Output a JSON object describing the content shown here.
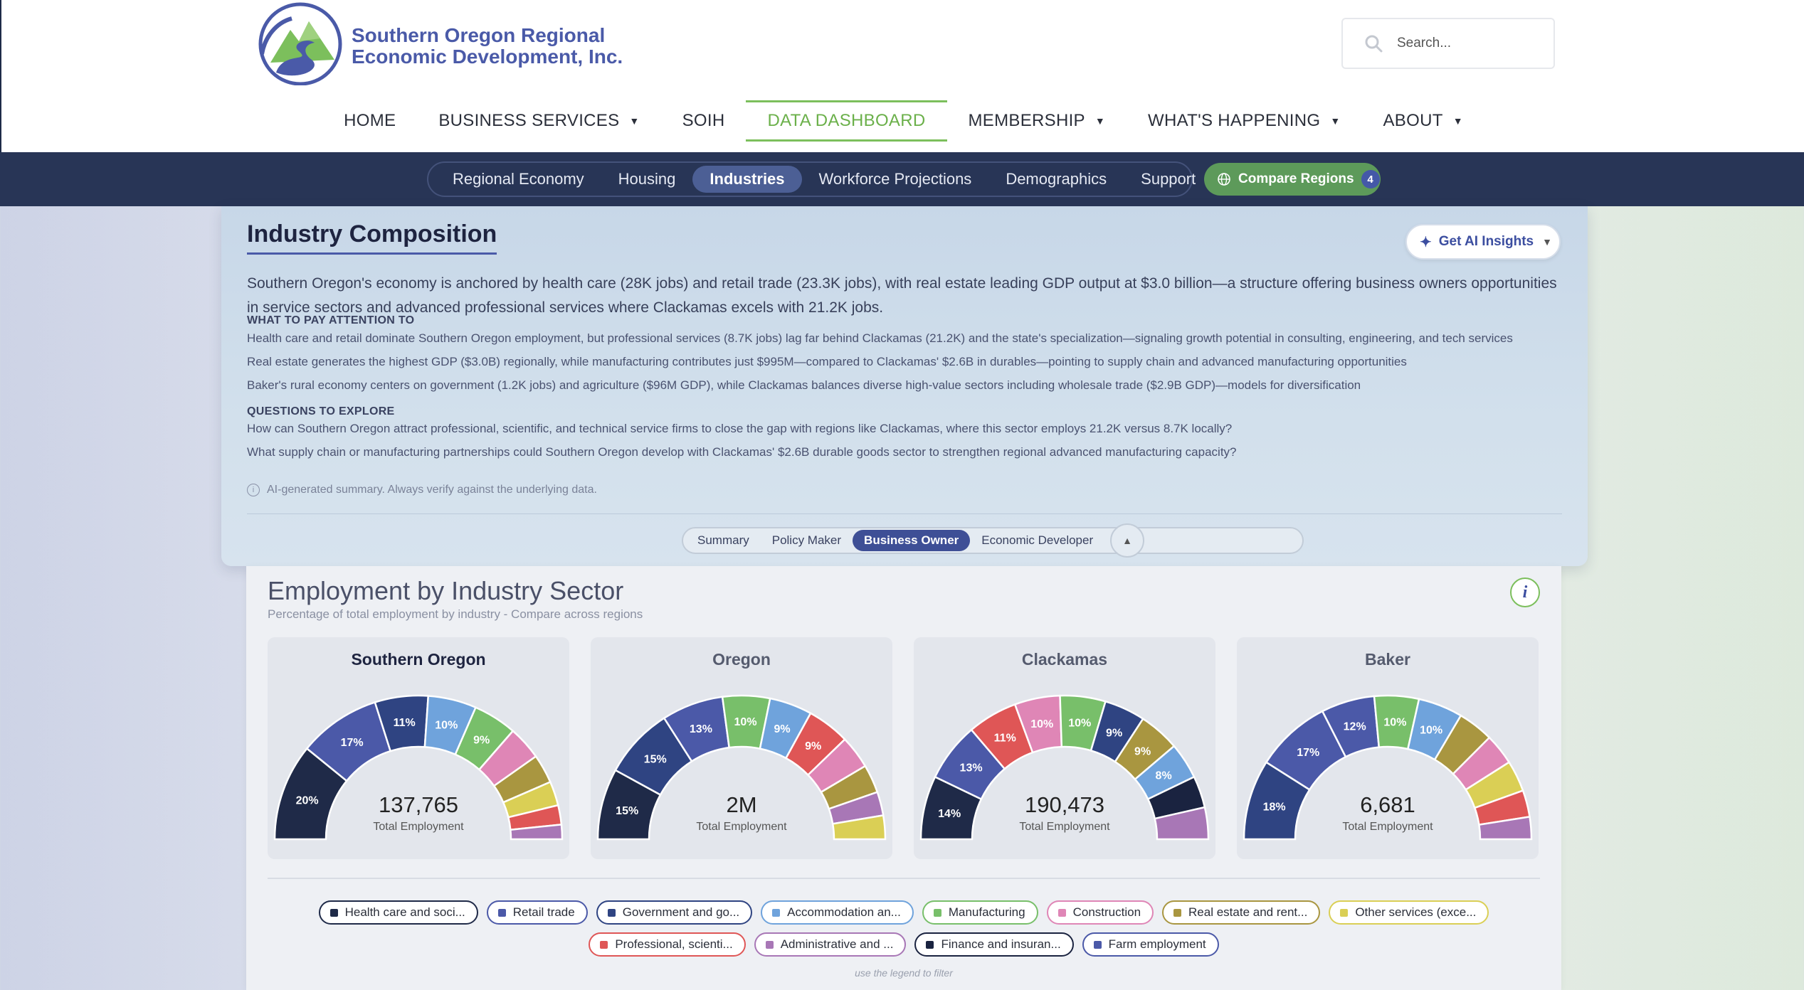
{
  "header": {
    "logo_line1": "Southern Oregon Regional",
    "logo_line2": "Economic Development, Inc.",
    "search_placeholder": "Search...",
    "nav": [
      {
        "label": "HOME",
        "dropdown": false,
        "active": false
      },
      {
        "label": "BUSINESS SERVICES",
        "dropdown": true,
        "active": false
      },
      {
        "label": "SOIH",
        "dropdown": false,
        "active": false
      },
      {
        "label": "DATA DASHBOARD",
        "dropdown": false,
        "active": true
      },
      {
        "label": "MEMBERSHIP",
        "dropdown": true,
        "active": false
      },
      {
        "label": "WHAT'S HAPPENING",
        "dropdown": true,
        "active": false
      },
      {
        "label": "ABOUT",
        "dropdown": true,
        "active": false
      }
    ]
  },
  "subnav": {
    "tabs": [
      {
        "label": "Regional Economy",
        "active": false
      },
      {
        "label": "Housing",
        "active": false
      },
      {
        "label": "Industries",
        "active": true
      },
      {
        "label": "Workforce Projections",
        "active": false
      },
      {
        "label": "Demographics",
        "active": false
      },
      {
        "label": "Support",
        "active": false
      }
    ],
    "compare_label": "Compare Regions",
    "compare_count": "4"
  },
  "insight": {
    "title": "Industry Composition",
    "ai_button": "Get AI Insights",
    "summary": "Southern Oregon's economy is anchored by health care (28K jobs) and retail trade (23.3K jobs), with real estate leading GDP output at $3.0 billion—a structure offering business owners opportunities in service sectors and advanced professional services where Clackamas excels with 21.2K jobs.",
    "attention_heading": "WHAT TO PAY ATTENTION TO",
    "attention": [
      "Health care and retail dominate Southern Oregon employment, but professional services (8.7K jobs) lag far behind Clackamas (21.2K) and the state's specialization—signaling growth potential in consulting, engineering, and tech services",
      "Real estate generates the highest GDP ($3.0B) regionally, while manufacturing contributes just $995M—compared to Clackamas' $2.6B in durables—pointing to supply chain and advanced manufacturing opportunities",
      "Baker's rural economy centers on government (1.2K jobs) and agriculture ($96M GDP), while Clackamas balances diverse high-value sectors including wholesale trade ($2.9B GDP)—models for diversification"
    ],
    "questions_heading": "QUESTIONS TO EXPLORE",
    "questions": [
      "How can Southern Oregon attract professional, scientific, and technical service firms to close the gap with regions like Clackamas, where this sector employs 21.2K versus 8.7K locally?",
      "What supply chain or manufacturing partnerships could Southern Oregon develop with Clackamas' $2.6B durable goods sector to strengthen regional advanced manufacturing capacity?"
    ],
    "disclaimer": "AI-generated summary. Always verify against the underlying data.",
    "personas": [
      {
        "label": "Summary",
        "active": false
      },
      {
        "label": "Policy Maker",
        "active": false
      },
      {
        "label": "Business Owner",
        "active": true
      },
      {
        "label": "Economic Developer",
        "active": false
      }
    ]
  },
  "chart_section": {
    "title": "Employment by Industry Sector",
    "subtitle": "Percentage of total employment by industry - Compare across regions",
    "total_label": "Total Employment",
    "legend_hint": "use the legend to filter"
  },
  "colors": {
    "Health care and soci...": "#1f2a48",
    "Retail trade": "#4b59a8",
    "Government and go...": "#2f4482",
    "Accommodation an...": "#6fa3dc",
    "Manufacturing": "#78bf6a",
    "Construction": "#df86b6",
    "Real estate and rent...": "#a99640",
    "Other services (exce...": "#dacf55",
    "Professional, scienti...": "#df5656",
    "Administrative and ...": "#a877b6",
    "Finance and insuran...": "#1a2340",
    "Farm employment": "#4b59a8"
  },
  "chart_data": [
    {
      "type": "pie",
      "title": "Southern Oregon",
      "total": "137,765",
      "categories": [
        "Health care and soci...",
        "Retail trade",
        "Government and go...",
        "Accommodation an...",
        "Manufacturing",
        "Construction",
        "Real estate and rent...",
        "Other services (exce...",
        "Professional, scienti...",
        "Administrative and ..."
      ],
      "values": [
        20,
        17,
        11,
        10,
        9,
        7,
        6,
        5,
        4,
        3
      ],
      "labels": [
        "20%",
        "17%",
        "11%",
        "10%",
        "9%",
        "",
        "",
        "",
        "",
        ""
      ]
    },
    {
      "type": "pie",
      "title": "Oregon",
      "total": "2M",
      "categories": [
        "Health care and soci...",
        "Government and go...",
        "Retail trade",
        "Manufacturing",
        "Accommodation an...",
        "Professional, scienti...",
        "Construction",
        "Real estate and rent...",
        "Administrative and ...",
        "Other services (exce..."
      ],
      "values": [
        15,
        15,
        13,
        10,
        9,
        9,
        7,
        6,
        5,
        5
      ],
      "labels": [
        "15%",
        "15%",
        "13%",
        "10%",
        "9%",
        "9%",
        "",
        "",
        "",
        ""
      ]
    },
    {
      "type": "pie",
      "title": "Clackamas",
      "total": "190,473",
      "categories": [
        "Health care and soci...",
        "Retail trade",
        "Professional, scienti...",
        "Construction",
        "Manufacturing",
        "Government and go...",
        "Real estate and rent...",
        "Accommodation an...",
        "Finance and insuran...",
        "Administrative and ..."
      ],
      "values": [
        14,
        13,
        11,
        10,
        10,
        9,
        9,
        8,
        7,
        7
      ],
      "labels": [
        "14%",
        "13%",
        "11%",
        "10%",
        "10%",
        "9%",
        "9%",
        "8%",
        "",
        ""
      ]
    },
    {
      "type": "pie",
      "title": "Baker",
      "total": "6,681",
      "categories": [
        "Government and go...",
        "Retail trade",
        "Farm employment",
        "Manufacturing",
        "Accommodation an...",
        "Real estate and rent...",
        "Construction",
        "Other services (exce...",
        "Professional, scienti...",
        "Administrative and ..."
      ],
      "values": [
        18,
        17,
        12,
        10,
        10,
        8,
        7,
        7,
        6,
        5
      ],
      "labels": [
        "18%",
        "17%",
        "12%",
        "10%",
        "10%",
        "",
        "",
        "",
        "",
        ""
      ]
    }
  ],
  "legend": [
    [
      "Health care and soci...",
      "Retail trade",
      "Government and go...",
      "Accommodation an...",
      "Manufacturing",
      "Construction",
      "Real estate and rent...",
      "Other services (exce..."
    ],
    [
      "Professional, scienti...",
      "Administrative and ...",
      "Finance and insuran...",
      "Farm employment"
    ]
  ]
}
